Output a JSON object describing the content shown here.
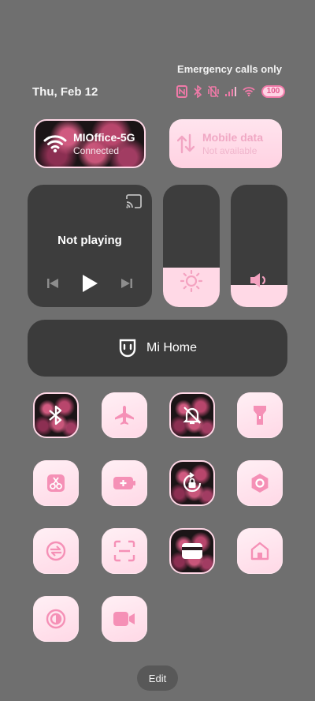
{
  "status": {
    "emergency_text": "Emergency calls only",
    "date": "Thu, Feb 12",
    "battery": "100"
  },
  "wifi_tile": {
    "name": "MIOffice-5G",
    "state": "Connected"
  },
  "mobile_tile": {
    "label": "Mobile data",
    "state": "Not available"
  },
  "media": {
    "title": "Not playing"
  },
  "sliders": {
    "brightness_level": 0.32,
    "volume_level": 0.18
  },
  "mihome": {
    "label": "Mi Home"
  },
  "edit_label": "Edit",
  "colors": {
    "accent_pink": "#ffd8e6",
    "icon_pink": "#f48fb4",
    "panel_dark": "#3d3d3d",
    "background": "#6f6f6f"
  },
  "toggles": [
    {
      "name": "bluetooth-icon",
      "style": "dark"
    },
    {
      "name": "airplane-icon",
      "style": "pink"
    },
    {
      "name": "mute-icon",
      "style": "dark"
    },
    {
      "name": "flashlight-icon",
      "style": "pink"
    },
    {
      "name": "screenshot-icon",
      "style": "pink"
    },
    {
      "name": "battery-saver-icon",
      "style": "pink"
    },
    {
      "name": "rotation-lock-icon",
      "style": "dark"
    },
    {
      "name": "settings-icon",
      "style": "pink"
    },
    {
      "name": "sync-icon",
      "style": "pink"
    },
    {
      "name": "scanner-icon",
      "style": "pink"
    },
    {
      "name": "card-icon",
      "style": "dark"
    },
    {
      "name": "home-icon",
      "style": "pink"
    },
    {
      "name": "reading-mode-icon",
      "style": "pink"
    },
    {
      "name": "screen-recorder-icon",
      "style": "pink"
    }
  ]
}
